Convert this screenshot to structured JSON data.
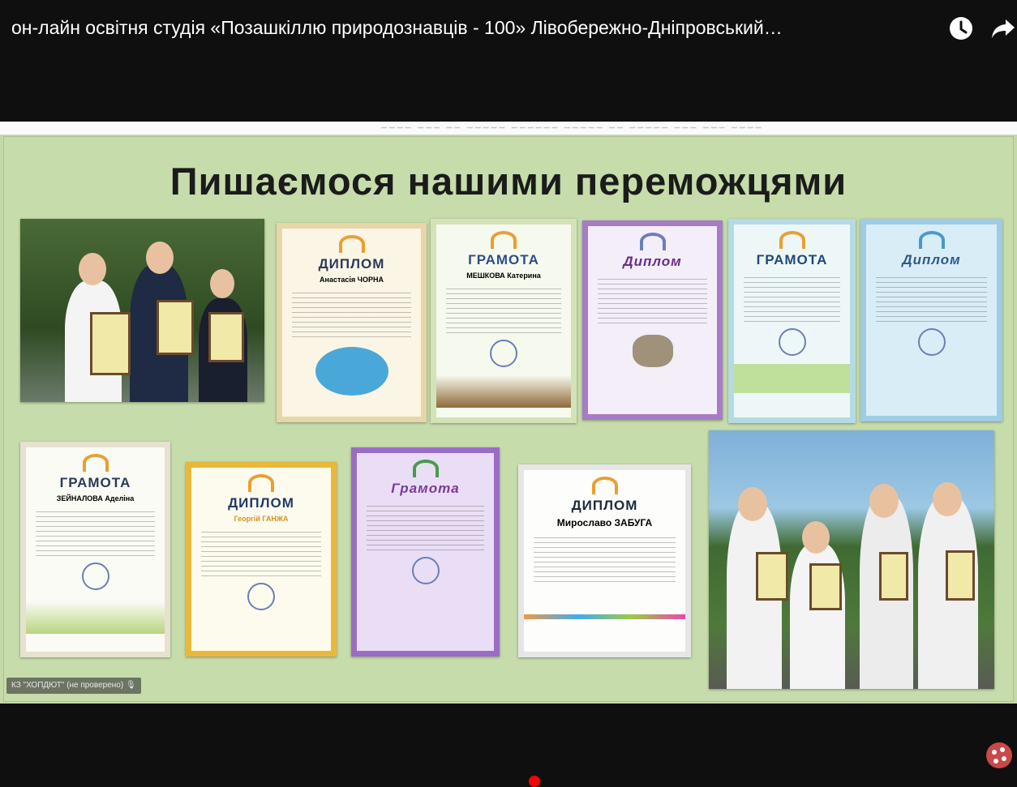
{
  "header": {
    "video_title": "он-лайн освітня студія «Позашкіллю природознавців - 100» Лівобережно-Дніпровський…",
    "watch_later_icon": "clock-icon",
    "share_icon": "share-arrow-icon"
  },
  "slide": {
    "title": "Пишаємося нашими переможцями",
    "certificates": [
      {
        "heading": "ДИПЛОМ",
        "name": "Анастасія ЧОРНА"
      },
      {
        "heading": "ГРАМОТА",
        "name": "МЕШКОВА Катерина"
      },
      {
        "heading": "Диплом",
        "name": ""
      },
      {
        "heading": "ГРАМОТА",
        "name": ""
      },
      {
        "heading": "Диплом",
        "name": ""
      },
      {
        "heading": "ГРАМОТА",
        "name": "ЗЕЙНАЛОВА Аделіна"
      },
      {
        "heading": "ДИПЛОМ",
        "name": "Георгій ГАНЖА"
      },
      {
        "heading": "Грамота",
        "name": ""
      },
      {
        "heading": "ДИПЛОМ",
        "name": "Мирославо ЗАБУГА"
      }
    ]
  },
  "caption": "КЗ \"ХОПДЮТ\" (не проверено)",
  "colors": {
    "accent_red": "#ff0000",
    "slide_bg": "#c6dcaa"
  }
}
